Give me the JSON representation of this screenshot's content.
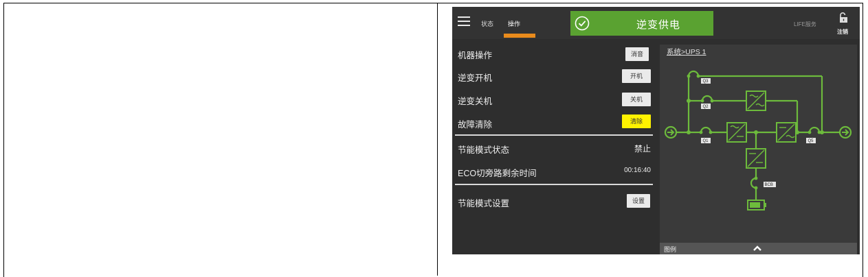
{
  "header": {
    "tabs": [
      {
        "label": "状态"
      },
      {
        "label": "操作"
      }
    ],
    "mode_text": "逆变供电",
    "life_label": "LIFE服务",
    "logout_label": "注销"
  },
  "operations": {
    "machine_ops_label": "机器操作",
    "mute_button": "消音",
    "inverter_on_label": "逆变开机",
    "on_button": "开机",
    "inverter_off_label": "逆变关机",
    "off_button": "关机",
    "fault_clear_label": "故障清除",
    "clear_button": "清除",
    "eco_state_label": "节能模式状态",
    "eco_state_value": "禁止",
    "eco_bypass_label": "ECO切旁路剩余时间",
    "eco_bypass_value": "00:16:40",
    "eco_setting_label": "节能模式设置",
    "setting_button": "设置"
  },
  "diagram": {
    "breadcrumb_root": "系统",
    "breadcrumb_sep": ">",
    "breadcrumb_leaf": "UPS 1",
    "switch_q3": "Q3",
    "switch_q2": "Q2",
    "switch_q1": "Q1",
    "switch_q5": "Q5",
    "switch_bcb": "BCB",
    "legend_label": "图例"
  },
  "colors": {
    "accent_green": "#5aa231",
    "tab_orange": "#e98b1c",
    "clear_yellow": "#fff200",
    "line_green": "#6dbb3c"
  }
}
